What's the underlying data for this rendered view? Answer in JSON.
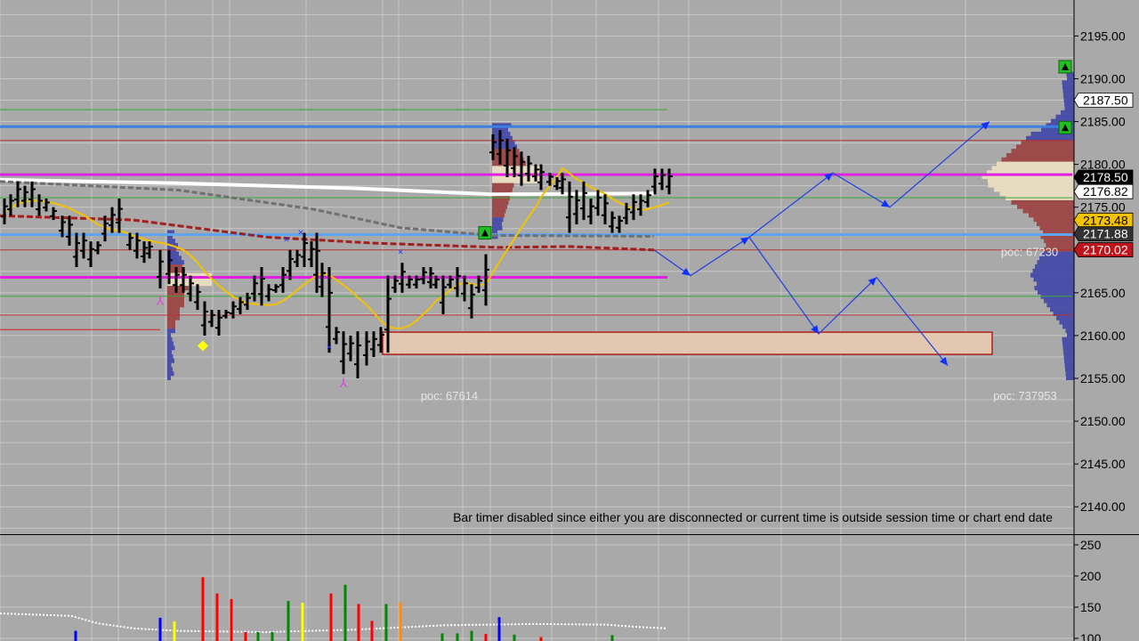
{
  "chart_data": {
    "type": "candlestick",
    "price_axis": {
      "ticks": [
        "2195.00",
        "2190.00",
        "2185.00",
        "2180.00",
        "2175.00",
        "2170.00",
        "2165.00",
        "2160.00",
        "2155.00",
        "2150.00",
        "2145.00",
        "2140.00"
      ],
      "ylim": [
        2136.8,
        2199.2
      ]
    },
    "price_tags": [
      {
        "label": "2187.50",
        "price": 2187.5,
        "bg": "#ffffff",
        "fg": "#000000"
      },
      {
        "label": "2178.50",
        "price": 2178.5,
        "bg": "#000000",
        "fg": "#ffffff"
      },
      {
        "label": "2176.82",
        "price": 2176.82,
        "bg": "#ffffff",
        "fg": "#000000"
      },
      {
        "label": "2173.48",
        "price": 2173.48,
        "bg": "#f2c200",
        "fg": "#000000"
      },
      {
        "label": "2171.88",
        "price": 2171.88,
        "bg": "#333333",
        "fg": "#ffffff"
      },
      {
        "label": "2170.02",
        "price": 2170.02,
        "bg": "#c0141c",
        "fg": "#ffffff"
      }
    ],
    "poc_labels": [
      {
        "text": "poc: 67614",
        "x": 505,
        "price": 2152.9
      },
      {
        "text": "poc: 737953",
        "x": 1152,
        "price": 2152.9
      },
      {
        "text": "poc: 67230",
        "x": 1157,
        "price": 2169.7
      }
    ],
    "horizontal_levels": [
      {
        "price": 2184.4,
        "color": "#3d7fe0",
        "width": 3,
        "from": 0,
        "to": 1205
      },
      {
        "price": 2171.8,
        "color": "#5ea4ee",
        "width": 3,
        "from": 0,
        "to": 1205
      },
      {
        "price": 2178.8,
        "color": "#e020e0",
        "width": 3,
        "from": 0,
        "to": 1205
      },
      {
        "price": 2166.8,
        "color": "#e020e0",
        "width": 3,
        "from": 0,
        "to": 750
      },
      {
        "price": 2186.4,
        "color": "#3aa83a",
        "width": 1,
        "from": 0,
        "to": 750
      },
      {
        "price": 2182.8,
        "color": "#b03030",
        "width": 1,
        "from": 0,
        "to": 1205
      },
      {
        "price": 2176.1,
        "color": "#3aa83a",
        "width": 1,
        "from": 0,
        "to": 1205
      },
      {
        "price": 2170.0,
        "color": "#b03030",
        "width": 1,
        "from": 0,
        "to": 1205
      },
      {
        "price": 2164.6,
        "color": "#3aa83a",
        "width": 1,
        "from": 0,
        "to": 1205
      },
      {
        "price": 2162.4,
        "color": "#b03030",
        "width": 1,
        "from": 0,
        "to": 1205
      },
      {
        "price": 2160.7,
        "color": "#d02020",
        "width": 1,
        "from": 0,
        "to": 180
      }
    ],
    "zone": {
      "x1": 430,
      "x2": 1115,
      "top": 2160.4,
      "bottom": 2157.8,
      "fill": "#e2c8b0",
      "stroke": "#b02020"
    },
    "bars": [
      [
        5,
        2176,
        2173
      ],
      [
        12,
        2176.5,
        2174
      ],
      [
        20,
        2178,
        2175
      ],
      [
        28,
        2177.5,
        2175
      ],
      [
        36,
        2178,
        2175
      ],
      [
        44,
        2176.5,
        2174
      ],
      [
        52,
        2176,
        2174.5
      ],
      [
        60,
        2175,
        2173.5
      ],
      [
        70,
        2174,
        2171.5
      ],
      [
        78,
        2174,
        2170.5
      ],
      [
        86,
        2172,
        2168
      ],
      [
        94,
        2172,
        2169
      ],
      [
        102,
        2171,
        2168
      ],
      [
        110,
        2171,
        2169.5
      ],
      [
        118,
        2174,
        2171
      ],
      [
        126,
        2175,
        2172
      ],
      [
        134,
        2176,
        2172
      ],
      [
        146,
        2172,
        2170
      ],
      [
        154,
        2172,
        2169
      ],
      [
        162,
        2171,
        2168.5
      ],
      [
        168,
        2171,
        2169
      ],
      [
        180,
        2170,
        2165.5
      ],
      [
        190,
        2170,
        2166
      ],
      [
        198,
        2168,
        2165
      ],
      [
        206,
        2168,
        2165
      ],
      [
        214,
        2167,
        2164
      ],
      [
        222,
        2166,
        2163
      ],
      [
        230,
        2164,
        2160
      ],
      [
        238,
        2163,
        2161
      ],
      [
        246,
        2163,
        2160
      ],
      [
        254,
        2163,
        2162
      ],
      [
        262,
        2164,
        2162
      ],
      [
        270,
        2164.5,
        2162.5
      ],
      [
        278,
        2165,
        2163
      ],
      [
        286,
        2167,
        2164
      ],
      [
        294,
        2168,
        2163.5
      ],
      [
        302,
        2166,
        2164
      ],
      [
        310,
        2166,
        2165
      ],
      [
        318,
        2168,
        2165
      ],
      [
        326,
        2170,
        2166.5
      ],
      [
        334,
        2170,
        2168
      ],
      [
        342,
        2172,
        2168
      ],
      [
        350,
        2171,
        2168
      ],
      [
        356,
        2172,
        2165
      ],
      [
        362,
        2168.5,
        2164.5
      ],
      [
        370,
        2168,
        2158
      ],
      [
        378,
        2161,
        2159
      ],
      [
        386,
        2160.5,
        2155.5
      ],
      [
        394,
        2160,
        2157
      ],
      [
        402,
        2160.5,
        2155
      ],
      [
        412,
        2160.5,
        2156.5
      ],
      [
        420,
        2160.5,
        2157.5
      ],
      [
        428,
        2161,
        2158
      ],
      [
        436,
        2167,
        2158
      ],
      [
        444,
        2167,
        2165
      ],
      [
        452,
        2168.5,
        2165
      ],
      [
        460,
        2167,
        2165.5
      ],
      [
        468,
        2167,
        2165.5
      ],
      [
        476,
        2168,
        2166
      ],
      [
        484,
        2168,
        2165.5
      ],
      [
        490,
        2167,
        2165.5
      ],
      [
        498,
        2167,
        2162.5
      ],
      [
        506,
        2167,
        2165.5
      ],
      [
        514,
        2168,
        2164.5
      ],
      [
        522,
        2167,
        2164
      ],
      [
        530,
        2166,
        2162
      ],
      [
        538,
        2167,
        2165
      ],
      [
        546,
        2169.5,
        2163.5
      ],
      [
        554,
        2183.5,
        2180.5
      ],
      [
        562,
        2184,
        2180
      ],
      [
        570,
        2183,
        2178.5
      ],
      [
        578,
        2182,
        2178.5
      ],
      [
        586,
        2181.5,
        2177.5
      ],
      [
        594,
        2181,
        2178
      ],
      [
        602,
        2180,
        2178
      ],
      [
        608,
        2180,
        2177
      ],
      [
        618,
        2179,
        2177.5
      ],
      [
        626,
        2178.5,
        2177
      ],
      [
        632,
        2179,
        2176.5
      ],
      [
        640,
        2178,
        2172
      ],
      [
        648,
        2177,
        2173
      ],
      [
        656,
        2178,
        2173.5
      ],
      [
        664,
        2176,
        2173
      ],
      [
        672,
        2177,
        2174
      ],
      [
        680,
        2176.5,
        2173
      ],
      [
        688,
        2174.5,
        2172
      ],
      [
        696,
        2174,
        2172
      ],
      [
        704,
        2175.5,
        2173
      ],
      [
        712,
        2176.5,
        2173.5
      ],
      [
        720,
        2176.5,
        2174
      ],
      [
        728,
        2177,
        2175
      ],
      [
        736,
        2179.5,
        2176.5
      ],
      [
        744,
        2179.5,
        2177
      ],
      [
        752,
        2179.5,
        2176.5
      ]
    ],
    "forecast_paths": [
      [
        [
          735,
          2170
        ],
        [
          776,
          2167
        ],
        [
          842,
          2171.5
        ],
        [
          936,
          2179
        ],
        [
          1000,
          2175
        ],
        [
          1112,
          2185
        ]
      ],
      [
        [
          842,
          2171.5
        ],
        [
          920,
          2160.2
        ],
        [
          985,
          2166.8
        ],
        [
          1065,
          2156.5
        ]
      ]
    ],
    "volume_axis": {
      "ticks": [
        "250",
        "200",
        "150",
        "100"
      ],
      "values": [
        250,
        200,
        150,
        100
      ]
    },
    "volume_bars": [
      [
        85,
        112,
        "#0000ff"
      ],
      [
        180,
        133,
        "#0000ff"
      ],
      [
        196,
        127,
        "#ffff00"
      ],
      [
        228,
        198,
        "#ff0000"
      ],
      [
        244,
        172,
        "#ff0000"
      ],
      [
        260,
        163,
        "#ff0000"
      ],
      [
        276,
        110,
        "#ff0000"
      ],
      [
        290,
        110,
        "#008800"
      ],
      [
        306,
        110,
        "#008800"
      ],
      [
        324,
        160,
        "#008800"
      ],
      [
        340,
        157,
        "#ffff00"
      ],
      [
        372,
        172,
        "#ff0000"
      ],
      [
        388,
        186,
        "#008800"
      ],
      [
        403,
        155,
        "#ff0000"
      ],
      [
        418,
        128,
        "#ff0000"
      ],
      [
        434,
        155,
        "#008800"
      ],
      [
        450,
        158,
        "#ff8c00"
      ],
      [
        497,
        108,
        "#008800"
      ],
      [
        514,
        108,
        "#008800"
      ],
      [
        530,
        112,
        "#008800"
      ],
      [
        546,
        107,
        "#ff0000"
      ],
      [
        561,
        134,
        "#0000ff"
      ],
      [
        578,
        106,
        "#008800"
      ],
      [
        608,
        102,
        "#ff0000"
      ],
      [
        688,
        105,
        "#008800"
      ]
    ],
    "notice": "Bar timer disabled since either you are disconnected or current time is outside session time or chart end date"
  }
}
